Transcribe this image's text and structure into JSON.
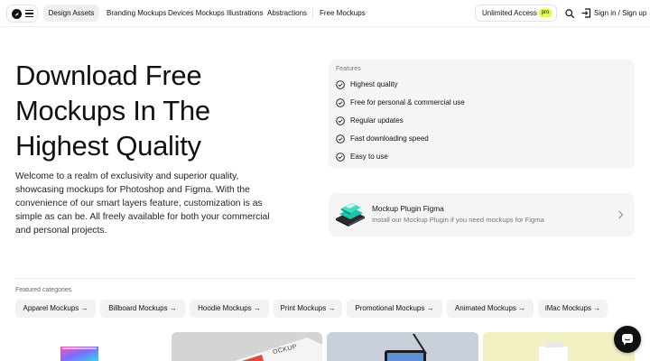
{
  "header": {
    "nav_primary": "Design Assets",
    "nav_links": [
      "Branding Mockups",
      "Devices Mockups",
      "Illustrations",
      "Abstractions"
    ],
    "nav_free": "Free Mockups",
    "unlimited_label": "Unlimited Access",
    "pro_badge": "pro",
    "signin_label": "Sign in / Sign up"
  },
  "hero": {
    "title_lines": [
      "Download Free",
      "Mockups In The",
      "Highest Quality"
    ],
    "description": "Welcome to a realm of exclusivity and superior quality, showcasing mockups for Photoshop and Figma. With the convenience of our smart layers feature, customization is as simple as can be. All freely available for both your commercial and personal projects."
  },
  "features": {
    "label": "Features",
    "items": [
      "Highest quality",
      "Free for personal & commercial use",
      "Regular updates",
      "Fast downloading speed",
      "Easy to use"
    ]
  },
  "plugin": {
    "title": "Mockup Plugin Figma",
    "subtitle": "Install our Mockup Plugin if you need mockups for Figma"
  },
  "categories": {
    "label": "Featured categories",
    "items": [
      "Apparel Mockups →",
      "Billboard Mockups →",
      "Hoodie Mockups →",
      "Print Mockups →",
      "Promotional Mockups →",
      "Animated Mockups →",
      "iMac Mockups →"
    ]
  },
  "thumbnails": {
    "card_2_text": "OCKUP"
  },
  "colors": {
    "accent_badge": "#e6f84a",
    "card_bg": "#f5f5f5",
    "chip_bg": "#f2f2f2",
    "text": "#111111"
  },
  "icons": {
    "logo": "logo-icon",
    "menu": "menu-icon",
    "search": "search-icon",
    "signin": "sign-in-icon",
    "check": "check-circle-icon",
    "chevron": "chevron-right-icon",
    "chat": "chat-icon"
  }
}
